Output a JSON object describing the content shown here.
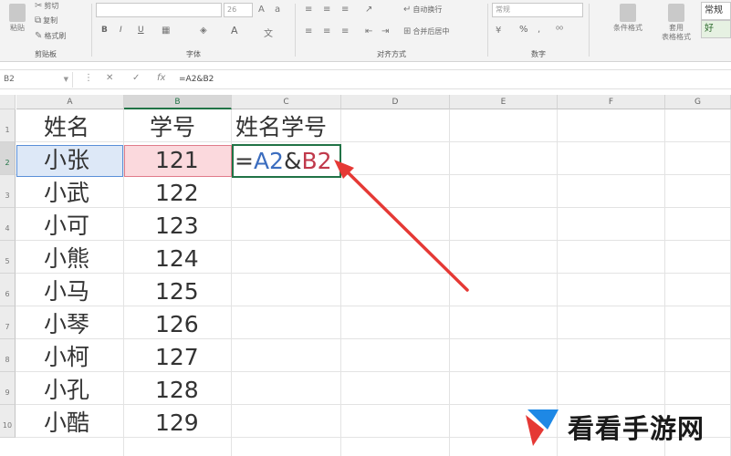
{
  "ribbon": {
    "clipboard": {
      "paste_label": "粘贴",
      "cut_label": "剪切",
      "copy_label": "复制",
      "format_painter_label": "格式刷",
      "group_label": "剪贴板"
    },
    "font": {
      "font_size": "26",
      "bold_label": "B",
      "italic_label": "I",
      "underline_label": "U",
      "font_color_label": "A",
      "group_label": "字体"
    },
    "alignment": {
      "wrap_text_label": "自动换行",
      "merge_center_label": "合并后居中",
      "group_label": "对齐方式"
    },
    "number": {
      "format_value": "常规",
      "percent_label": "%",
      "group_label": "数字"
    },
    "styles": {
      "conditional_label": "条件格式",
      "table_format_label_1": "套用",
      "table_format_label_2": "表格格式",
      "normal_label": "常规",
      "good_label": "好"
    }
  },
  "formula_bar": {
    "name_box": "B2",
    "cancel_label": "✕",
    "enter_label": "✓",
    "fx_label": "fx",
    "formula": "=A2&B2"
  },
  "columns": [
    "A",
    "B",
    "C",
    "D",
    "E",
    "F",
    "G"
  ],
  "rows": [
    "1",
    "2",
    "3",
    "4",
    "5",
    "6",
    "7",
    "8",
    "9",
    "10"
  ],
  "headers": {
    "name": "姓名",
    "id": "学号",
    "name_id": "姓名学号"
  },
  "data_rows": [
    {
      "name": "小张",
      "id": "121"
    },
    {
      "name": "小武",
      "id": "122"
    },
    {
      "name": "小可",
      "id": "123"
    },
    {
      "name": "小熊",
      "id": "124"
    },
    {
      "name": "小马",
      "id": "125"
    },
    {
      "name": "小琴",
      "id": "126"
    },
    {
      "name": "小柯",
      "id": "127"
    },
    {
      "name": "小孔",
      "id": "128"
    },
    {
      "name": "小酷",
      "id": "129"
    }
  ],
  "editing_cell": {
    "eq": "=",
    "ref_a": "A2",
    "amp": "&",
    "ref_b": "B2"
  },
  "watermark": {
    "text": "看看手游网"
  },
  "colors": {
    "accent_green": "#217346",
    "ref_blue": "#3b6dbf",
    "ref_red": "#c0394b",
    "arrow_red": "#e53935"
  }
}
